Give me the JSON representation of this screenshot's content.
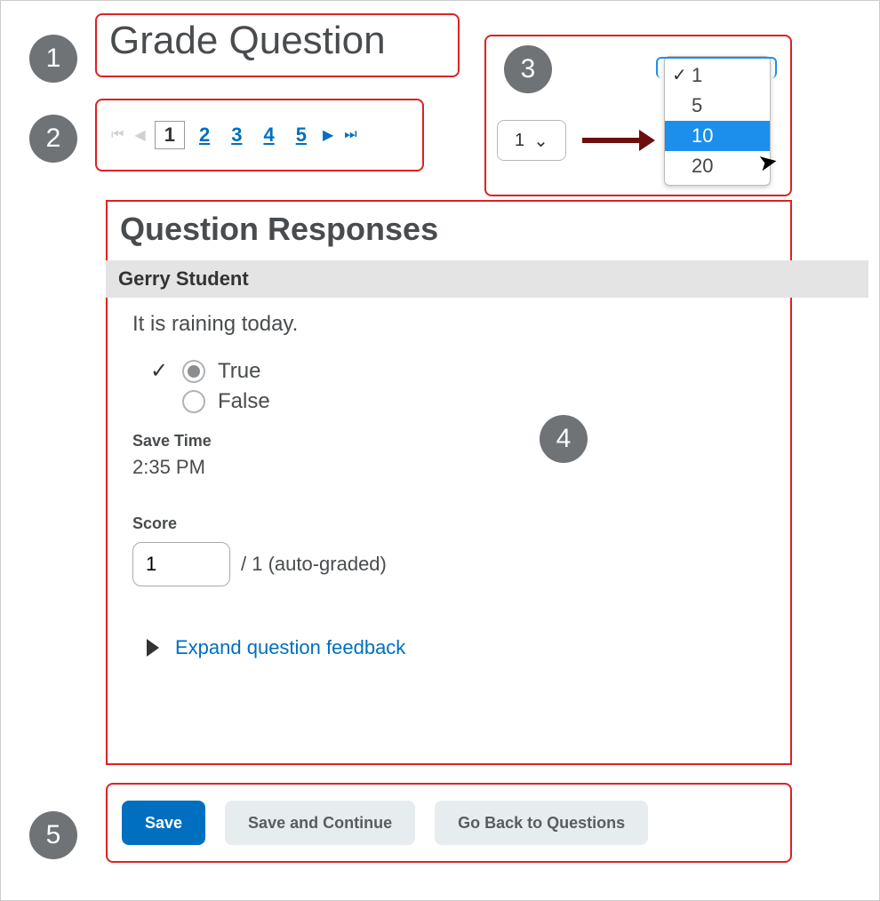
{
  "callouts": {
    "c1": "1",
    "c2": "2",
    "c3": "3",
    "c4": "4",
    "c5": "5"
  },
  "title": "Grade Question",
  "pagination": {
    "pages": [
      "1",
      "2",
      "3",
      "4",
      "5"
    ],
    "current": "1"
  },
  "per_page": {
    "selected": "1",
    "options": [
      "1",
      "5",
      "10",
      "20"
    ],
    "highlighted": "10"
  },
  "responses": {
    "heading": "Question Responses",
    "student_name": "Gerry Student",
    "question_text": "It is raining today.",
    "options": {
      "true_label": "True",
      "false_label": "False"
    },
    "save_time_label": "Save Time",
    "save_time_value": "2:35 PM",
    "score_label": "Score",
    "score_value": "1",
    "score_denom": "/ 1  (auto-graded)",
    "expand_label": "Expand question feedback"
  },
  "buttons": {
    "save": "Save",
    "save_continue": "Save and Continue",
    "back": "Go Back to Questions"
  }
}
